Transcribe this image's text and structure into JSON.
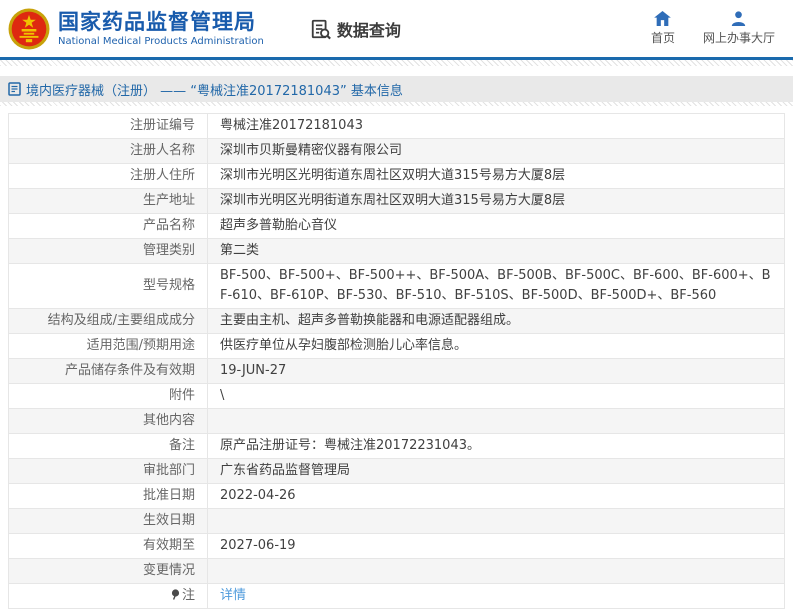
{
  "header": {
    "title": "国家药品监督管理局",
    "subtitle": "National Medical Products Administration",
    "data_query_label": "数据查询",
    "nav": [
      {
        "label": "首页",
        "icon": "home-icon"
      },
      {
        "label": "网上办事大厅",
        "icon": "person-icon"
      }
    ]
  },
  "breadcrumb": {
    "text": "境内医疗器械（注册） —— “粤械注准20172181043” 基本信息"
  },
  "table": {
    "rows": [
      {
        "label": "注册证编号",
        "value": "粤械注准20172181043"
      },
      {
        "label": "注册人名称",
        "value": "深圳市贝斯曼精密仪器有限公司"
      },
      {
        "label": "注册人住所",
        "value": "深圳市光明区光明街道东周社区双明大道315号易方大厦8层"
      },
      {
        "label": "生产地址",
        "value": "深圳市光明区光明街道东周社区双明大道315号易方大厦8层"
      },
      {
        "label": "产品名称",
        "value": "超声多普勒胎心音仪"
      },
      {
        "label": "管理类别",
        "value": "第二类"
      },
      {
        "label": "型号规格",
        "value": "BF-500、BF-500+、BF-500++、BF-500A、BF-500B、BF-500C、BF-600、BF-600+、BF-610、BF-610P、BF-530、BF-510、BF-510S、BF-500D、BF-500D+、BF-560"
      },
      {
        "label": "结构及组成/主要组成成分",
        "value": "主要由主机、超声多普勒换能器和电源适配器组成。"
      },
      {
        "label": "适用范围/预期用途",
        "value": "供医疗单位从孕妇腹部检测胎儿心率信息。"
      },
      {
        "label": "产品储存条件及有效期",
        "value": "19-JUN-27"
      },
      {
        "label": "附件",
        "value": "\\"
      },
      {
        "label": "其他内容",
        "value": ""
      },
      {
        "label": "备注",
        "value": "原产品注册证号：粤械注准20172231043。"
      },
      {
        "label": "审批部门",
        "value": "广东省药品监督管理局"
      },
      {
        "label": "批准日期",
        "value": "2022-04-26"
      },
      {
        "label": "生效日期",
        "value": ""
      },
      {
        "label": "有效期至",
        "value": "2027-06-19"
      },
      {
        "label": "变更情况",
        "value": ""
      },
      {
        "label": "注",
        "value": "详情",
        "is_link": true
      }
    ]
  },
  "colors": {
    "title_blue": "#185bac",
    "header_line_blue": "#1a6aad",
    "breadcrumb_bg": "#e9e9e9",
    "breadcrumb_text": "#2268a8",
    "row_alt_bg": "#f5f5f5",
    "table_border": "#e6e6e6",
    "link_blue": "#4f9bdc",
    "emblem_red": "#de2910",
    "emblem_gold": "#f0c300"
  }
}
